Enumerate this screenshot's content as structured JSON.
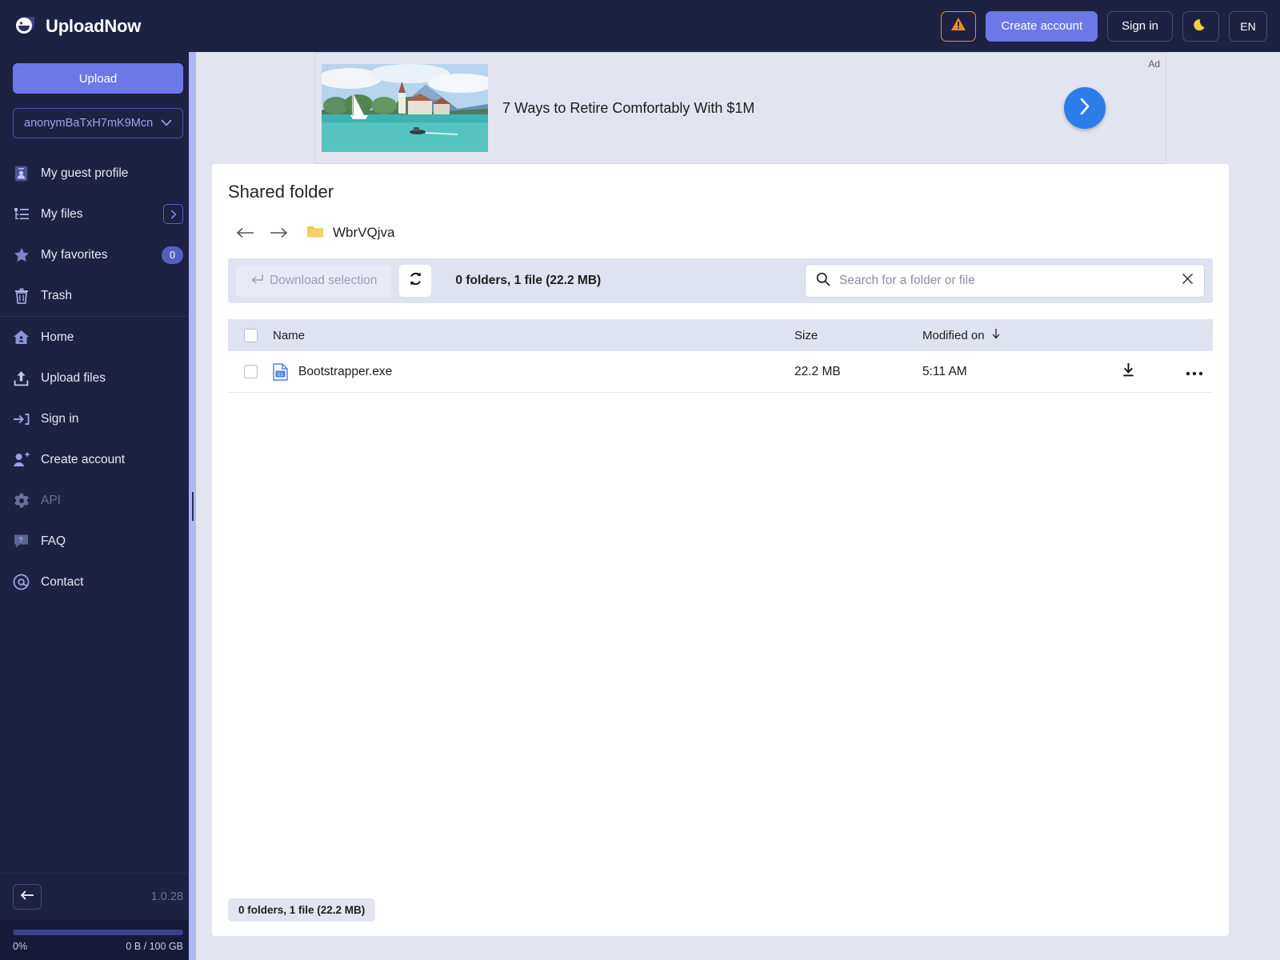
{
  "header": {
    "brand": "UploadNow",
    "logo_icon": "cloud-smile-logo",
    "warning_icon": "warning-triangle-icon",
    "create_account": "Create account",
    "sign_in": "Sign in",
    "theme_icon": "moon-icon",
    "language": "EN"
  },
  "sidebar": {
    "upload_button": "Upload",
    "account": {
      "label": "anonymBaTxH7mK9Mcn",
      "chevron_icon": "chevron-down-icon"
    },
    "items": [
      {
        "label": "My guest profile",
        "icon": "id-card-icon",
        "badge": null,
        "chevron": false,
        "muted": false
      },
      {
        "label": "My files",
        "icon": "file-tree-icon",
        "badge": null,
        "chevron": true,
        "muted": false
      },
      {
        "label": "My favorites",
        "icon": "star-icon",
        "badge": "0",
        "chevron": false,
        "muted": false
      },
      {
        "label": "Trash",
        "icon": "trash-icon",
        "badge": null,
        "chevron": false,
        "muted": false
      },
      {
        "label": "Home",
        "icon": "home-icon",
        "badge": null,
        "chevron": false,
        "muted": false
      },
      {
        "label": "Upload files",
        "icon": "upload-arrow-icon",
        "badge": null,
        "chevron": false,
        "muted": false
      },
      {
        "label": "Sign in",
        "icon": "sign-in-icon",
        "badge": null,
        "chevron": false,
        "muted": false
      },
      {
        "label": "Create account",
        "icon": "user-plus-icon",
        "badge": null,
        "chevron": false,
        "muted": false
      },
      {
        "label": "API",
        "icon": "gear-icon",
        "badge": null,
        "chevron": false,
        "muted": true
      },
      {
        "label": "FAQ",
        "icon": "question-bubble-icon",
        "badge": null,
        "chevron": false,
        "muted": false
      },
      {
        "label": "Contact",
        "icon": "at-sign-icon",
        "badge": null,
        "chevron": false,
        "muted": false
      }
    ],
    "collapse_icon": "arrow-left-icon",
    "version": "1.0.28",
    "quota": {
      "percent_label": "0%",
      "usage_label": "0 B / 100 GB",
      "percent_value": 0
    }
  },
  "ad": {
    "label": "Ad",
    "title": "7 Ways to Retire Comfortably With $1M",
    "next_icon": "chevron-right-icon",
    "thumbnail_alt": "lake-church-mountains-photo"
  },
  "content": {
    "title": "Shared folder",
    "breadcrumb": {
      "back_icon": "arrow-left-icon",
      "forward_icon": "arrow-right-icon",
      "folder_icon": "folder-icon",
      "folder_name": "WbrVQjva"
    },
    "toolbar": {
      "download_selection": "Download selection",
      "download_icon": "enter-arrow-icon",
      "refresh_icon": "refresh-icon",
      "summary": "0 folders, 1 file (22.2 MB)"
    },
    "search": {
      "placeholder": "Search for a folder or file",
      "value": "",
      "search_icon": "search-icon",
      "clear_icon": "close-icon"
    },
    "table": {
      "columns": {
        "name": "Name",
        "size": "Size",
        "modified": "Modified on",
        "sort_icon": "arrow-down-icon"
      },
      "rows": [
        {
          "name": "Bootstrapper.exe",
          "size": "22.2 MB",
          "modified": "5:11 AM",
          "file_icon": "binary-file-icon",
          "download_icon": "download-icon",
          "more_icon": "more-options-icon"
        }
      ]
    },
    "footer_badge": "0 folders, 1 file (22.2 MB)"
  },
  "colors": {
    "brand_dark": "#1d2142",
    "accent": "#6d78e8",
    "warning": "#f08a20",
    "page_bg": "#e2e5ef",
    "ad_blue": "#2b7de9"
  }
}
